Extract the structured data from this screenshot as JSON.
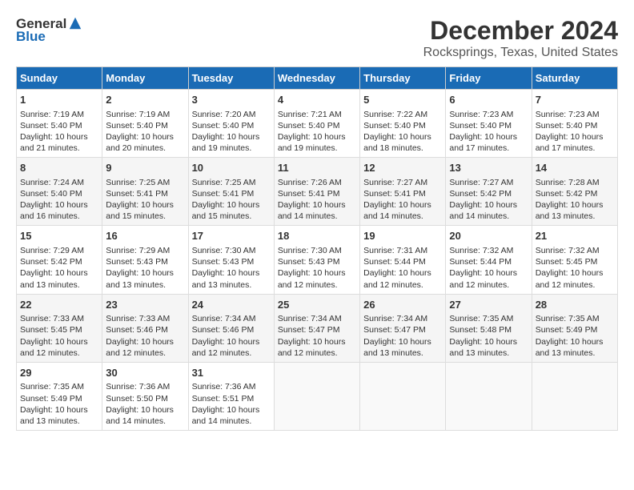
{
  "logo": {
    "general": "General",
    "blue": "Blue"
  },
  "title": "December 2024",
  "subtitle": "Rocksprings, Texas, United States",
  "headers": [
    "Sunday",
    "Monday",
    "Tuesday",
    "Wednesday",
    "Thursday",
    "Friday",
    "Saturday"
  ],
  "weeks": [
    [
      {
        "day": "1",
        "sunrise": "Sunrise: 7:19 AM",
        "sunset": "Sunset: 5:40 PM",
        "daylight": "Daylight: 10 hours and 21 minutes."
      },
      {
        "day": "2",
        "sunrise": "Sunrise: 7:19 AM",
        "sunset": "Sunset: 5:40 PM",
        "daylight": "Daylight: 10 hours and 20 minutes."
      },
      {
        "day": "3",
        "sunrise": "Sunrise: 7:20 AM",
        "sunset": "Sunset: 5:40 PM",
        "daylight": "Daylight: 10 hours and 19 minutes."
      },
      {
        "day": "4",
        "sunrise": "Sunrise: 7:21 AM",
        "sunset": "Sunset: 5:40 PM",
        "daylight": "Daylight: 10 hours and 19 minutes."
      },
      {
        "day": "5",
        "sunrise": "Sunrise: 7:22 AM",
        "sunset": "Sunset: 5:40 PM",
        "daylight": "Daylight: 10 hours and 18 minutes."
      },
      {
        "day": "6",
        "sunrise": "Sunrise: 7:23 AM",
        "sunset": "Sunset: 5:40 PM",
        "daylight": "Daylight: 10 hours and 17 minutes."
      },
      {
        "day": "7",
        "sunrise": "Sunrise: 7:23 AM",
        "sunset": "Sunset: 5:40 PM",
        "daylight": "Daylight: 10 hours and 17 minutes."
      }
    ],
    [
      {
        "day": "8",
        "sunrise": "Sunrise: 7:24 AM",
        "sunset": "Sunset: 5:40 PM",
        "daylight": "Daylight: 10 hours and 16 minutes."
      },
      {
        "day": "9",
        "sunrise": "Sunrise: 7:25 AM",
        "sunset": "Sunset: 5:41 PM",
        "daylight": "Daylight: 10 hours and 15 minutes."
      },
      {
        "day": "10",
        "sunrise": "Sunrise: 7:25 AM",
        "sunset": "Sunset: 5:41 PM",
        "daylight": "Daylight: 10 hours and 15 minutes."
      },
      {
        "day": "11",
        "sunrise": "Sunrise: 7:26 AM",
        "sunset": "Sunset: 5:41 PM",
        "daylight": "Daylight: 10 hours and 14 minutes."
      },
      {
        "day": "12",
        "sunrise": "Sunrise: 7:27 AM",
        "sunset": "Sunset: 5:41 PM",
        "daylight": "Daylight: 10 hours and 14 minutes."
      },
      {
        "day": "13",
        "sunrise": "Sunrise: 7:27 AM",
        "sunset": "Sunset: 5:42 PM",
        "daylight": "Daylight: 10 hours and 14 minutes."
      },
      {
        "day": "14",
        "sunrise": "Sunrise: 7:28 AM",
        "sunset": "Sunset: 5:42 PM",
        "daylight": "Daylight: 10 hours and 13 minutes."
      }
    ],
    [
      {
        "day": "15",
        "sunrise": "Sunrise: 7:29 AM",
        "sunset": "Sunset: 5:42 PM",
        "daylight": "Daylight: 10 hours and 13 minutes."
      },
      {
        "day": "16",
        "sunrise": "Sunrise: 7:29 AM",
        "sunset": "Sunset: 5:43 PM",
        "daylight": "Daylight: 10 hours and 13 minutes."
      },
      {
        "day": "17",
        "sunrise": "Sunrise: 7:30 AM",
        "sunset": "Sunset: 5:43 PM",
        "daylight": "Daylight: 10 hours and 13 minutes."
      },
      {
        "day": "18",
        "sunrise": "Sunrise: 7:30 AM",
        "sunset": "Sunset: 5:43 PM",
        "daylight": "Daylight: 10 hours and 12 minutes."
      },
      {
        "day": "19",
        "sunrise": "Sunrise: 7:31 AM",
        "sunset": "Sunset: 5:44 PM",
        "daylight": "Daylight: 10 hours and 12 minutes."
      },
      {
        "day": "20",
        "sunrise": "Sunrise: 7:32 AM",
        "sunset": "Sunset: 5:44 PM",
        "daylight": "Daylight: 10 hours and 12 minutes."
      },
      {
        "day": "21",
        "sunrise": "Sunrise: 7:32 AM",
        "sunset": "Sunset: 5:45 PM",
        "daylight": "Daylight: 10 hours and 12 minutes."
      }
    ],
    [
      {
        "day": "22",
        "sunrise": "Sunrise: 7:33 AM",
        "sunset": "Sunset: 5:45 PM",
        "daylight": "Daylight: 10 hours and 12 minutes."
      },
      {
        "day": "23",
        "sunrise": "Sunrise: 7:33 AM",
        "sunset": "Sunset: 5:46 PM",
        "daylight": "Daylight: 10 hours and 12 minutes."
      },
      {
        "day": "24",
        "sunrise": "Sunrise: 7:34 AM",
        "sunset": "Sunset: 5:46 PM",
        "daylight": "Daylight: 10 hours and 12 minutes."
      },
      {
        "day": "25",
        "sunrise": "Sunrise: 7:34 AM",
        "sunset": "Sunset: 5:47 PM",
        "daylight": "Daylight: 10 hours and 12 minutes."
      },
      {
        "day": "26",
        "sunrise": "Sunrise: 7:34 AM",
        "sunset": "Sunset: 5:47 PM",
        "daylight": "Daylight: 10 hours and 13 minutes."
      },
      {
        "day": "27",
        "sunrise": "Sunrise: 7:35 AM",
        "sunset": "Sunset: 5:48 PM",
        "daylight": "Daylight: 10 hours and 13 minutes."
      },
      {
        "day": "28",
        "sunrise": "Sunrise: 7:35 AM",
        "sunset": "Sunset: 5:49 PM",
        "daylight": "Daylight: 10 hours and 13 minutes."
      }
    ],
    [
      {
        "day": "29",
        "sunrise": "Sunrise: 7:35 AM",
        "sunset": "Sunset: 5:49 PM",
        "daylight": "Daylight: 10 hours and 13 minutes."
      },
      {
        "day": "30",
        "sunrise": "Sunrise: 7:36 AM",
        "sunset": "Sunset: 5:50 PM",
        "daylight": "Daylight: 10 hours and 14 minutes."
      },
      {
        "day": "31",
        "sunrise": "Sunrise: 7:36 AM",
        "sunset": "Sunset: 5:51 PM",
        "daylight": "Daylight: 10 hours and 14 minutes."
      },
      null,
      null,
      null,
      null
    ]
  ]
}
